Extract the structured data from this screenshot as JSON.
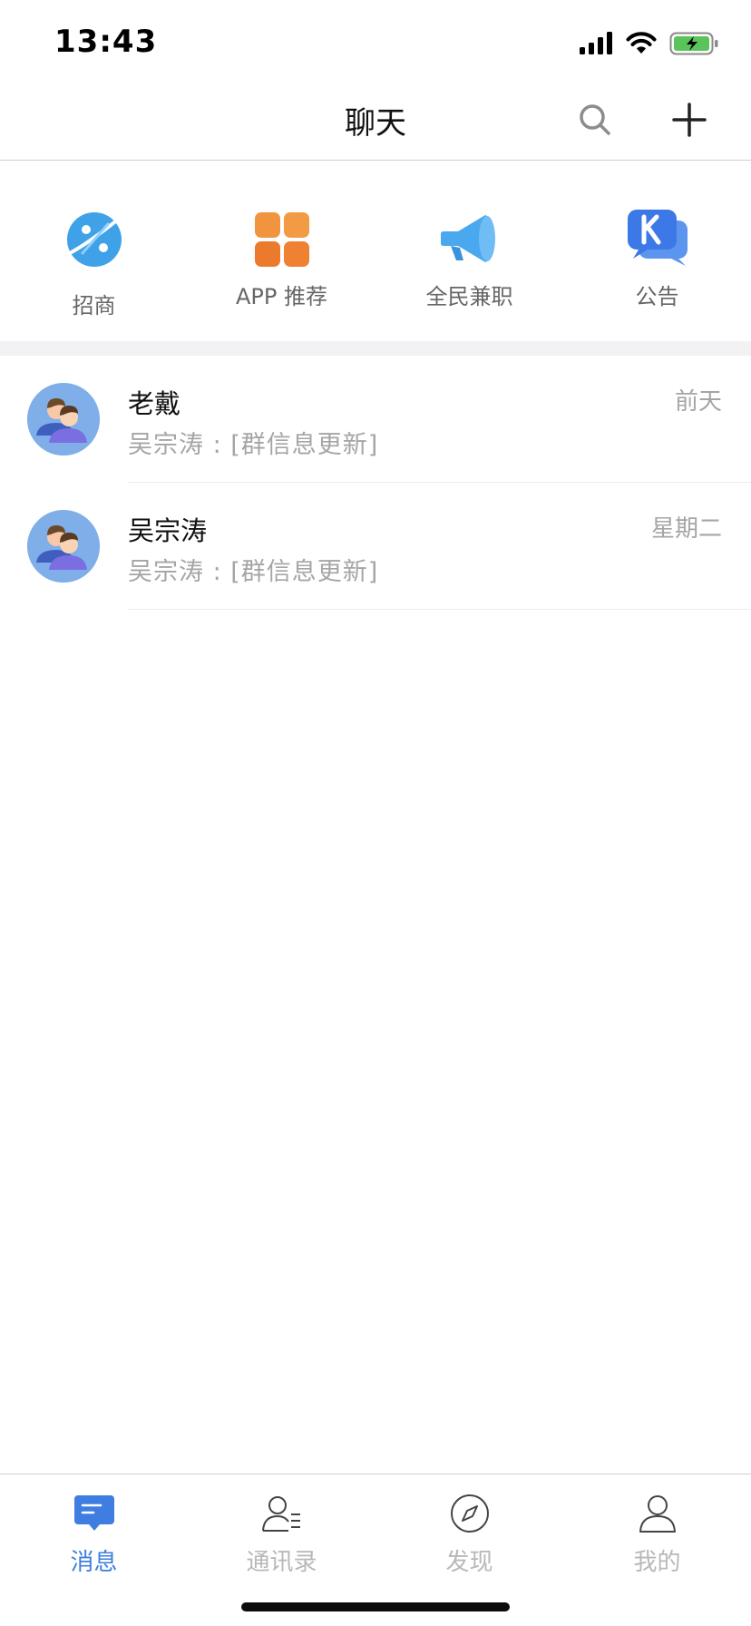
{
  "status_bar": {
    "time": "13:43",
    "icons": [
      "signal-icon",
      "wifi-icon",
      "battery-charging-icon"
    ],
    "battery_color": "#5ac35a"
  },
  "nav": {
    "title": "聊天",
    "icons": [
      "search-icon",
      "plus-icon"
    ]
  },
  "shortcuts": [
    {
      "label": "招商",
      "icon": "planet-percent-icon",
      "color": "#3fa1e8"
    },
    {
      "label": "APP 推荐",
      "icon": "app-grid-icon",
      "color": "#f08a33"
    },
    {
      "label": "全民兼职",
      "icon": "megaphone-icon",
      "color": "#4aa8ee"
    },
    {
      "label": "公告",
      "icon": "k-chat-icon",
      "color": "#3d79e6"
    }
  ],
  "chats": [
    {
      "name": "老戴",
      "preview": "吴宗涛 : [群信息更新]",
      "time": "前天",
      "avatar": "group-avatar-icon"
    },
    {
      "name": "吴宗涛",
      "preview": "吴宗涛 : [群信息更新]",
      "time": "星期二",
      "avatar": "group-avatar-icon"
    }
  ],
  "tabs": [
    {
      "label": "消息",
      "icon": "message-icon",
      "active": true
    },
    {
      "label": "通讯录",
      "icon": "contacts-icon",
      "active": false
    },
    {
      "label": "发现",
      "icon": "compass-icon",
      "active": false
    },
    {
      "label": "我的",
      "icon": "profile-icon",
      "active": false
    }
  ],
  "colors": {
    "accent": "#3f7ee0",
    "muted_text": "#a5a5a8",
    "inactive_tab": "#b8b8bb"
  }
}
